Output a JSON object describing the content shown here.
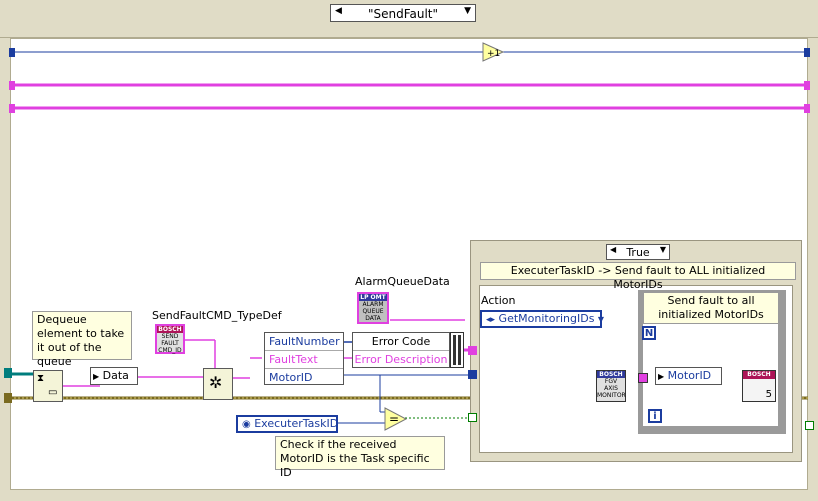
{
  "case_selector": {
    "value": "\"SendFault\""
  },
  "increment": {
    "label": "+1"
  },
  "dequeue_label": {
    "text": "Dequeue element to take it out of the queue"
  },
  "data_tag": {
    "text": "Data"
  },
  "typedef": {
    "label": "SendFaultCMD_TypeDef",
    "icon_text": [
      "BOSCH",
      "SEND",
      "FAULT",
      "CMD_ID"
    ]
  },
  "alarm": {
    "label": "AlarmQueueData",
    "icon_text": [
      "LP OMT",
      "ALARM",
      "QUEUE",
      "DATA"
    ]
  },
  "unbundle": {
    "fields": [
      "FaultNumber",
      "FaultText",
      "MotorID"
    ]
  },
  "bundle": {
    "fields": [
      "Error Code",
      "Error Description"
    ]
  },
  "task_const": {
    "label": "ExecuterTaskID"
  },
  "check_label": {
    "text": "Check if the received MotorID is the Task specific ID"
  },
  "inner_case": {
    "selector": "True",
    "description": "ExecuterTaskID -> Send fault to ALL initialized MotorIDs",
    "action_label": "Action",
    "action_value": "GetMonitoringIDs",
    "fgv_text": [
      "BOSCH",
      "FGV",
      "AXIS",
      "MONITOR"
    ],
    "for_loop": {
      "label": "Send fault to all initialized MotorIDs",
      "n": "N",
      "i": "i",
      "motor_tag": "MotorID",
      "count": "5",
      "bosch_text": "BOSCH"
    }
  },
  "colors": {
    "frame": "#e0dcc6",
    "pink_wire": "#e040e0",
    "blue_wire": "#1b3c9f",
    "cluster_wire": "#7a6a20",
    "error_wire": "#b2a04c"
  }
}
